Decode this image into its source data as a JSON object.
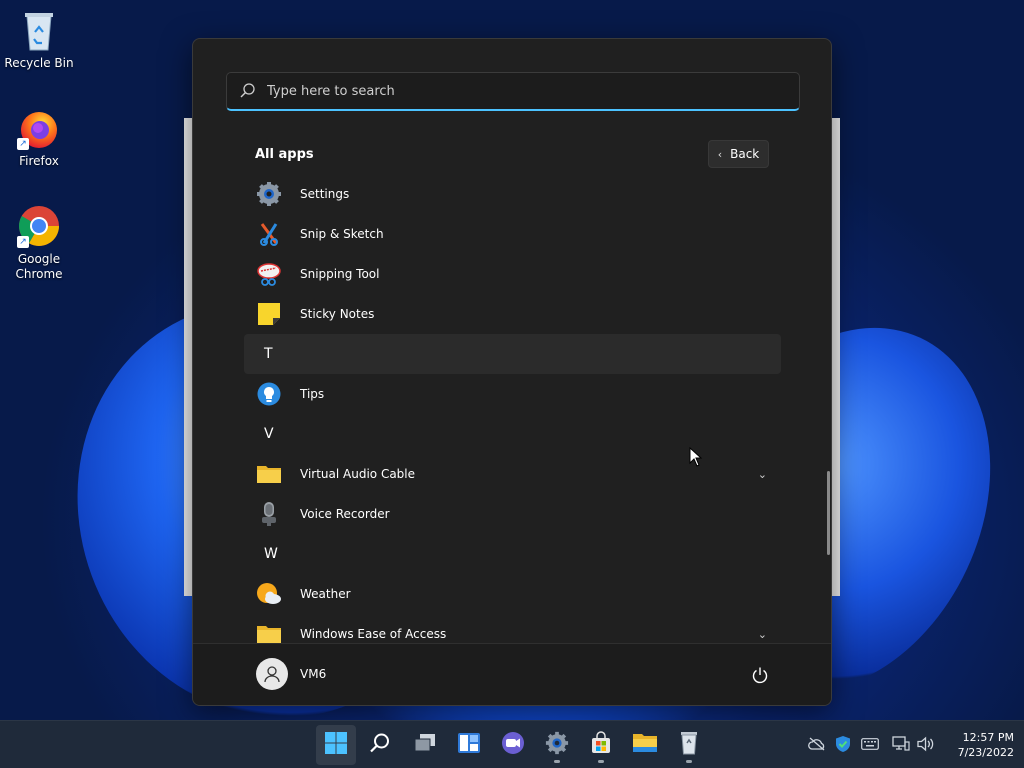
{
  "desktop": {
    "icons": [
      {
        "label": "Recycle Bin",
        "icon": "recycle-bin-icon"
      },
      {
        "label": "Firefox",
        "icon": "firefox-icon"
      },
      {
        "label": "Google Chrome",
        "icon": "chrome-icon"
      }
    ]
  },
  "start_menu": {
    "search": {
      "placeholder": "Type here to search"
    },
    "section_title": "All apps",
    "back_label": "Back",
    "items": [
      {
        "type": "app",
        "label": "Settings",
        "icon": "settings-icon"
      },
      {
        "type": "app",
        "label": "Snip & Sketch",
        "icon": "snip-sketch-icon"
      },
      {
        "type": "app",
        "label": "Snipping Tool",
        "icon": "snipping-tool-icon"
      },
      {
        "type": "app",
        "label": "Sticky Notes",
        "icon": "sticky-notes-icon"
      },
      {
        "type": "letter",
        "label": "T",
        "highlighted": true
      },
      {
        "type": "app",
        "label": "Tips",
        "icon": "tips-icon"
      },
      {
        "type": "letter",
        "label": "V"
      },
      {
        "type": "folder",
        "label": "Virtual Audio Cable",
        "icon": "folder-icon",
        "expandable": true
      },
      {
        "type": "app",
        "label": "Voice Recorder",
        "icon": "voice-recorder-icon"
      },
      {
        "type": "letter",
        "label": "W"
      },
      {
        "type": "app",
        "label": "Weather",
        "icon": "weather-icon"
      },
      {
        "type": "folder",
        "label": "Windows Ease of Access",
        "icon": "folder-icon",
        "expandable": true
      }
    ],
    "user": {
      "name": "VM6"
    }
  },
  "taskbar": {
    "apps": [
      {
        "name": "start",
        "icon": "windows-start-icon",
        "active": true
      },
      {
        "name": "search",
        "icon": "search-icon"
      },
      {
        "name": "task-view",
        "icon": "task-view-icon"
      },
      {
        "name": "widgets",
        "icon": "widgets-icon"
      },
      {
        "name": "chat",
        "icon": "teams-chat-icon"
      },
      {
        "name": "settings",
        "icon": "settings-icon",
        "running": true
      },
      {
        "name": "store",
        "icon": "store-icon",
        "running": true
      },
      {
        "name": "file-explorer",
        "icon": "file-explorer-icon"
      },
      {
        "name": "recycle",
        "icon": "recycle-bin-icon",
        "running": true
      }
    ],
    "tray": {
      "time": "12:57 PM",
      "date": "7/23/2022"
    }
  },
  "colors": {
    "accent": "#4cc2ff",
    "menu_bg": "#202020",
    "taskbar_bg": "#1f2a3a"
  }
}
